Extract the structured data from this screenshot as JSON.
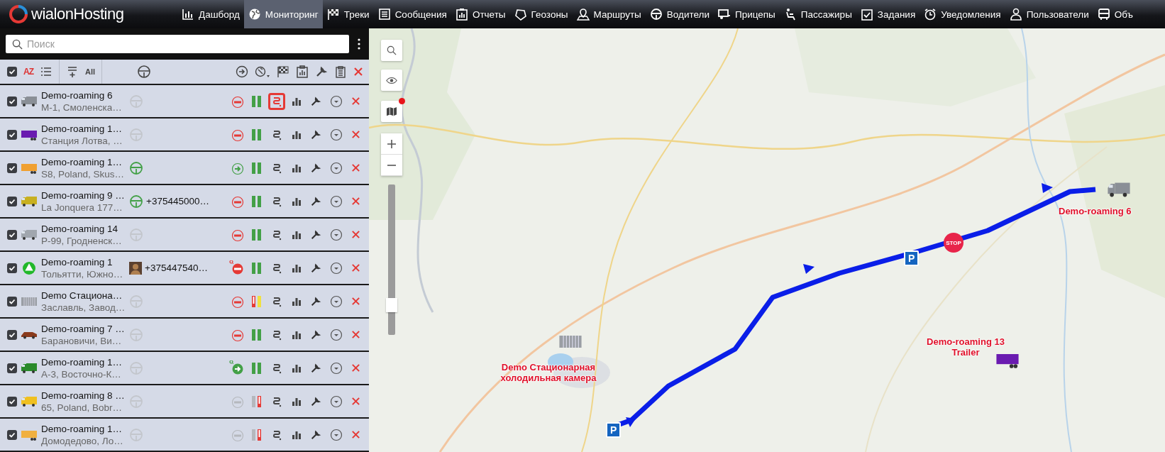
{
  "logo": {
    "text": "wialonHosting"
  },
  "nav": [
    {
      "label": "Дашборд",
      "selected": false
    },
    {
      "label": "Мониторинг",
      "selected": true
    },
    {
      "label": "Треки",
      "selected": false
    },
    {
      "label": "Сообщения",
      "selected": false
    },
    {
      "label": "Отчеты",
      "selected": false
    },
    {
      "label": "Геозоны",
      "selected": false
    },
    {
      "label": "Маршруты",
      "selected": false
    },
    {
      "label": "Водители",
      "selected": false
    },
    {
      "label": "Прицепы",
      "selected": false
    },
    {
      "label": "Пассажиры",
      "selected": false
    },
    {
      "label": "Задания",
      "selected": false
    },
    {
      "label": "Уведомления",
      "selected": false
    },
    {
      "label": "Пользователи",
      "selected": false
    },
    {
      "label": "Объ",
      "selected": false
    }
  ],
  "search": {
    "placeholder": "Поиск"
  },
  "toolbar": {
    "all_checked": true,
    "sort_label": "AZ",
    "show_all_label": "All"
  },
  "units": [
    {
      "name": "Demo-roaming 6",
      "address": "М-1, Смоленска…",
      "kind": "truck",
      "color": "#8a8f96",
      "checked": true,
      "driver_active": false,
      "moving": false,
      "sensor_alert": false,
      "offline": false,
      "pin": false,
      "track_active": true
    },
    {
      "name": "Demo-roaming 1…",
      "address": "Станция Лотва, …",
      "kind": "trailer",
      "color": "#6a1bb0",
      "checked": true,
      "driver_active": false,
      "moving": false,
      "sensor_alert": false,
      "offline": false,
      "pin": false,
      "track_active": false
    },
    {
      "name": "Demo-roaming 1…",
      "address": "S8, Poland, Skus…",
      "kind": "trailer",
      "color": "#f0a030",
      "checked": true,
      "driver_active": true,
      "moving": true,
      "sensor_alert": false,
      "offline": false,
      "pin": false,
      "track_active": false
    },
    {
      "name": "Demo-roaming 9 …",
      "address": "La Jonquera 177…",
      "kind": "truck",
      "color": "#c8b020",
      "checked": true,
      "driver_active": true,
      "phone": "+375445000…",
      "moving": false,
      "sensor_alert": false,
      "offline": false,
      "pin": false,
      "track_active": false
    },
    {
      "name": "Demo-roaming 14",
      "address": "Р-99, Гродненск…",
      "kind": "truck",
      "color": "#a0a6ae",
      "checked": true,
      "driver_active": false,
      "moving": false,
      "sensor_alert": false,
      "offline": false,
      "pin": false,
      "track_active": false
    },
    {
      "name": "Demo-roaming 1",
      "address": "Тольятти, Южно…",
      "kind": "arrow",
      "color": "#22b82a",
      "checked": true,
      "driver_photo": true,
      "phone": "+375447540…",
      "moving": false,
      "sensor_alert": false,
      "offline": false,
      "pin": true,
      "track_active": false
    },
    {
      "name": "Demo Стациона…",
      "address": "Заславль, Завод…",
      "kind": "container",
      "color": "#9a9ea4",
      "checked": true,
      "driver_active": false,
      "moving": false,
      "sensor_alert": true,
      "offline": false,
      "pin": false,
      "track_active": false
    },
    {
      "name": "Demo-roaming 7 …",
      "address": "Барановичи, Ви…",
      "kind": "car",
      "color": "#8a3a1c",
      "checked": true,
      "driver_active": false,
      "moving": false,
      "sensor_alert": false,
      "offline": false,
      "pin": false,
      "track_active": false
    },
    {
      "name": "Demo-roaming 1…",
      "address": "А-3, Восточно-К…",
      "kind": "truck",
      "color": "#2a8a2a",
      "checked": true,
      "driver_active": false,
      "moving": true,
      "sensor_alert": false,
      "offline": false,
      "pin": true,
      "track_active": false
    },
    {
      "name": "Demo-roaming 8 …",
      "address": "65, Poland, Bobr…",
      "kind": "truck",
      "color": "#f0c020",
      "checked": true,
      "driver_active": false,
      "moving": false,
      "sensor_alert": false,
      "offline": true,
      "pin": false,
      "track_active": false
    },
    {
      "name": "Demo-roaming 1…",
      "address": "Домодедово, Ло…",
      "kind": "trailer",
      "color": "#f0b040",
      "checked": true,
      "driver_active": false,
      "moving": false,
      "sensor_alert": false,
      "offline": true,
      "pin": false,
      "track_active": false
    }
  ],
  "map": {
    "layers_notice": true,
    "zoom": {
      "level": 0.2
    },
    "labels": [
      {
        "text": "Demo-roaming 6"
      },
      {
        "text": "Demo Стационарная холодильная камера"
      },
      {
        "text": "Demo-roaming 13 Trailer"
      }
    ],
    "markers": [
      {
        "kind": "truck",
        "color": "#8a8f96"
      },
      {
        "kind": "trailer",
        "color": "#6a1bb0"
      },
      {
        "kind": "container",
        "color": "#9a9ea4"
      },
      {
        "kind": "parking",
        "text": "P"
      },
      {
        "kind": "parking",
        "text": "P"
      },
      {
        "kind": "stop",
        "text": "STOP"
      }
    ]
  }
}
